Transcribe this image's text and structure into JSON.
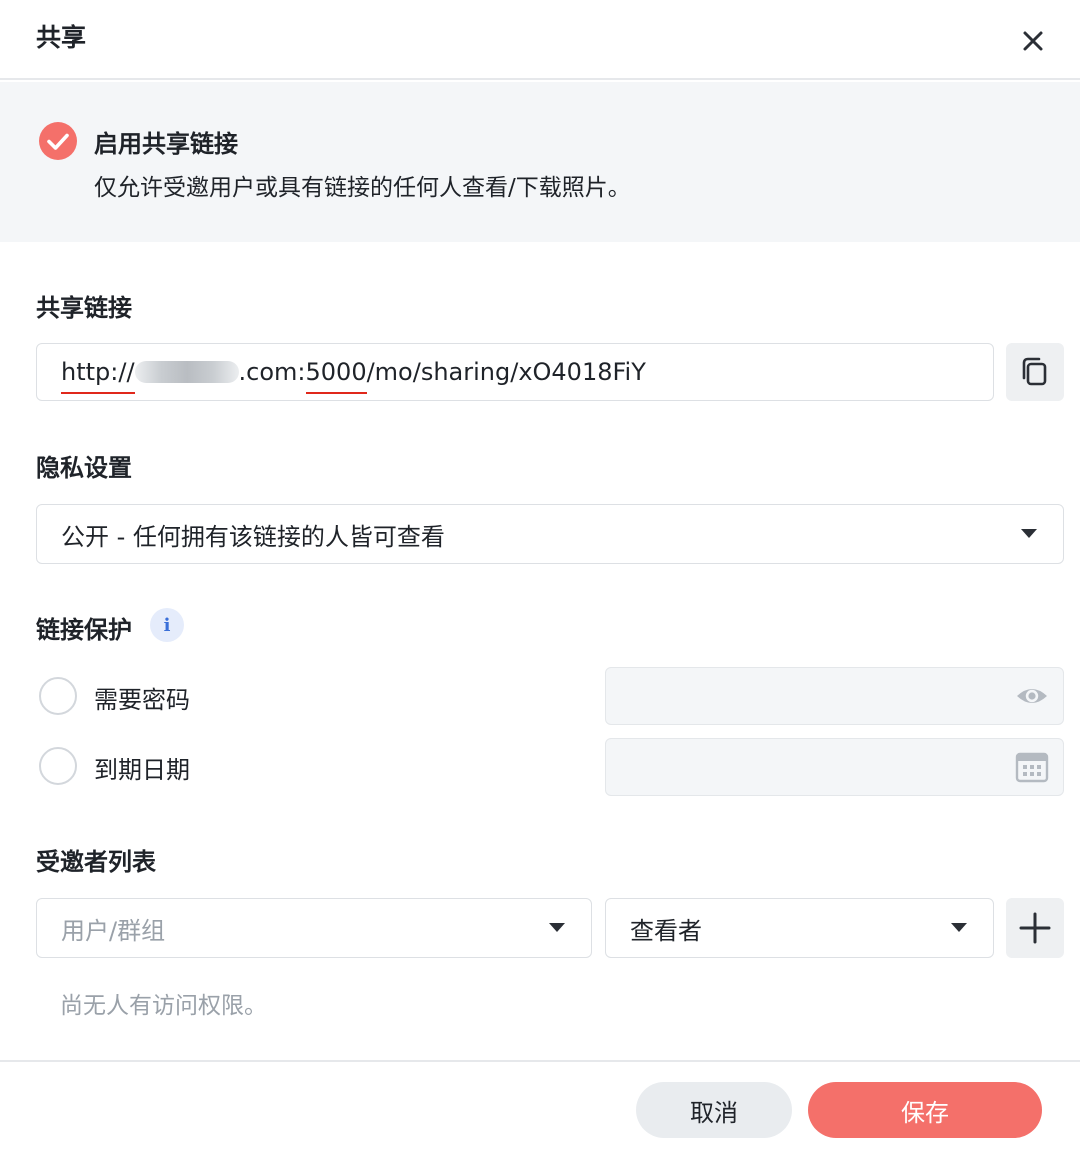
{
  "dialog": {
    "title": "共享"
  },
  "banner": {
    "title": "启用共享链接",
    "description": "仅允许受邀用户或具有链接的任何人查看/下载照片。",
    "enabled": true,
    "accent_color": "#f4706a"
  },
  "share_link": {
    "label": "共享链接",
    "url_prefix": "http://",
    "url_host_suffix": ".com:",
    "url_port": "5000",
    "url_path": "/mo/sharing/xO4018FiY",
    "copy_icon": "copy-icon"
  },
  "privacy": {
    "label": "隐私设置",
    "selected": "公开 - 任何拥有该链接的人皆可查看"
  },
  "protection": {
    "label": "链接保护",
    "info_glyph": "i",
    "password_option": "需要密码",
    "expiry_option": "到期日期",
    "password_checked": false,
    "expiry_checked": false,
    "password_icon": "eye-icon",
    "date_icon": "calendar-icon"
  },
  "invitees": {
    "label": "受邀者列表",
    "user_placeholder": "用户/群组",
    "role_selected": "查看者",
    "empty_text": "尚无人有访问权限。",
    "add_icon": "plus-icon"
  },
  "footer": {
    "cancel_label": "取消",
    "save_label": "保存",
    "save_color": "#f4706a"
  }
}
